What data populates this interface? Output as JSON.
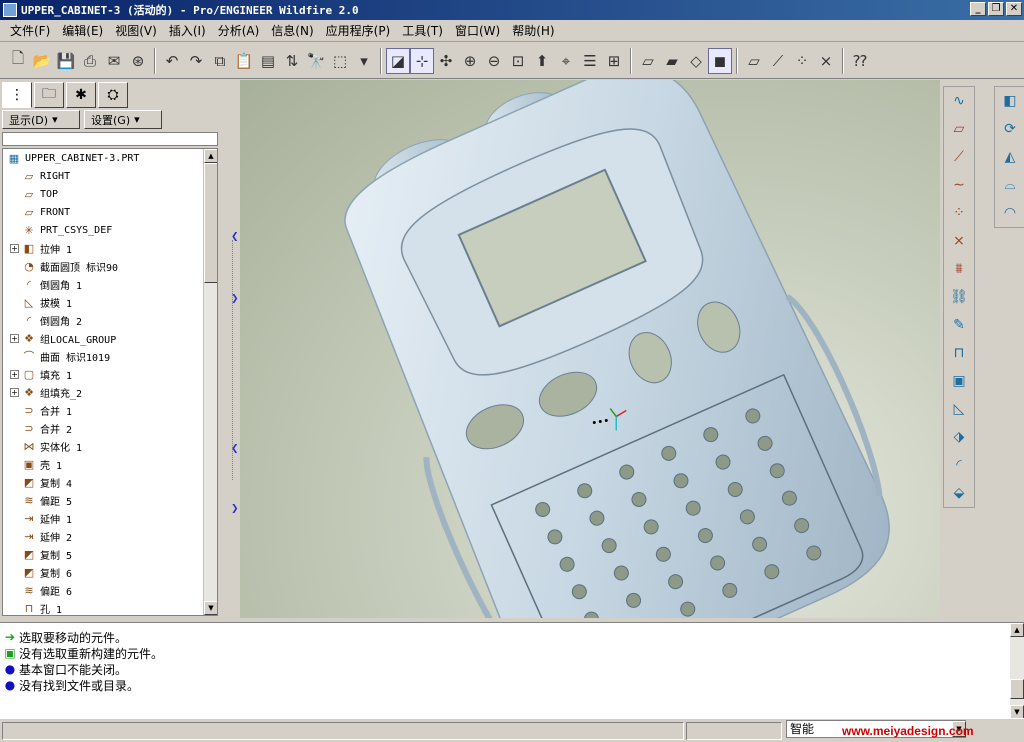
{
  "window": {
    "title": "UPPER_CABINET-3 (活动的) - Pro/ENGINEER Wildfire 2.0",
    "buttons": [
      "_",
      "❐",
      "✕"
    ]
  },
  "menu": [
    "文件(F)",
    "编辑(E)",
    "视图(V)",
    "插入(I)",
    "分析(A)",
    "信息(N)",
    "应用程序(P)",
    "工具(T)",
    "窗口(W)",
    "帮助(H)"
  ],
  "navigator": {
    "show_label": "显示(D)",
    "settings_label": "设置(G)"
  },
  "tree": [
    {
      "label": "UPPER_CABINET-3.PRT",
      "icon": "part-icon",
      "expand": false,
      "root": true
    },
    {
      "label": "RIGHT",
      "icon": "datum-plane-icon",
      "expand": false
    },
    {
      "label": "TOP",
      "icon": "datum-plane-icon",
      "expand": false
    },
    {
      "label": "FRONT",
      "icon": "datum-plane-icon",
      "expand": false
    },
    {
      "label": "PRT_CSYS_DEF",
      "icon": "csys-icon",
      "expand": false
    },
    {
      "label": "拉伸 1",
      "icon": "extrude-icon",
      "expand": true
    },
    {
      "label": "截面圆顶 标识90",
      "icon": "dome-icon",
      "expand": false
    },
    {
      "label": "倒圆角 1",
      "icon": "round-icon",
      "expand": false
    },
    {
      "label": "拔模 1",
      "icon": "draft-icon",
      "expand": false
    },
    {
      "label": "倒圆角 2",
      "icon": "round-icon",
      "expand": false
    },
    {
      "label": "组LOCAL_GROUP",
      "icon": "group-icon",
      "expand": true
    },
    {
      "label": "曲面 标识1019",
      "icon": "surface-icon",
      "expand": false
    },
    {
      "label": "填充 1",
      "icon": "fill-icon",
      "expand": true
    },
    {
      "label": "组填充_2",
      "icon": "group-icon",
      "expand": true
    },
    {
      "label": "合并 1",
      "icon": "merge-icon",
      "expand": false
    },
    {
      "label": "合并 2",
      "icon": "merge-icon",
      "expand": false
    },
    {
      "label": "实体化 1",
      "icon": "solidify-icon",
      "expand": false
    },
    {
      "label": "壳 1",
      "icon": "shell-icon",
      "expand": false
    },
    {
      "label": "复制 4",
      "icon": "copy-icon",
      "expand": false
    },
    {
      "label": "偏距 5",
      "icon": "offset-icon",
      "expand": false
    },
    {
      "label": "延伸 1",
      "icon": "extend-icon",
      "expand": false
    },
    {
      "label": "延伸 2",
      "icon": "extend-icon",
      "expand": false
    },
    {
      "label": "复制 5",
      "icon": "copy-icon",
      "expand": false
    },
    {
      "label": "复制 6",
      "icon": "copy-icon",
      "expand": false
    },
    {
      "label": "偏距 6",
      "icon": "offset-icon",
      "expand": false
    },
    {
      "label": "孔 1",
      "icon": "hole-icon",
      "expand": false
    }
  ],
  "messages": [
    {
      "icon": "arrow",
      "text": "选取要移动的元件。"
    },
    {
      "icon": "box",
      "text": "没有选取重新构建的元件。"
    },
    {
      "icon": "dot",
      "text": "基本窗口不能关闭。"
    },
    {
      "icon": "dot",
      "text": "没有找到文件或目录。"
    }
  ],
  "status": {
    "filter": "智能",
    "watermark": "www.meiyadesign.com"
  },
  "colors": {
    "titlebar": "#0a246a",
    "model": "#c7d7e3",
    "background": "#b7bea9"
  }
}
